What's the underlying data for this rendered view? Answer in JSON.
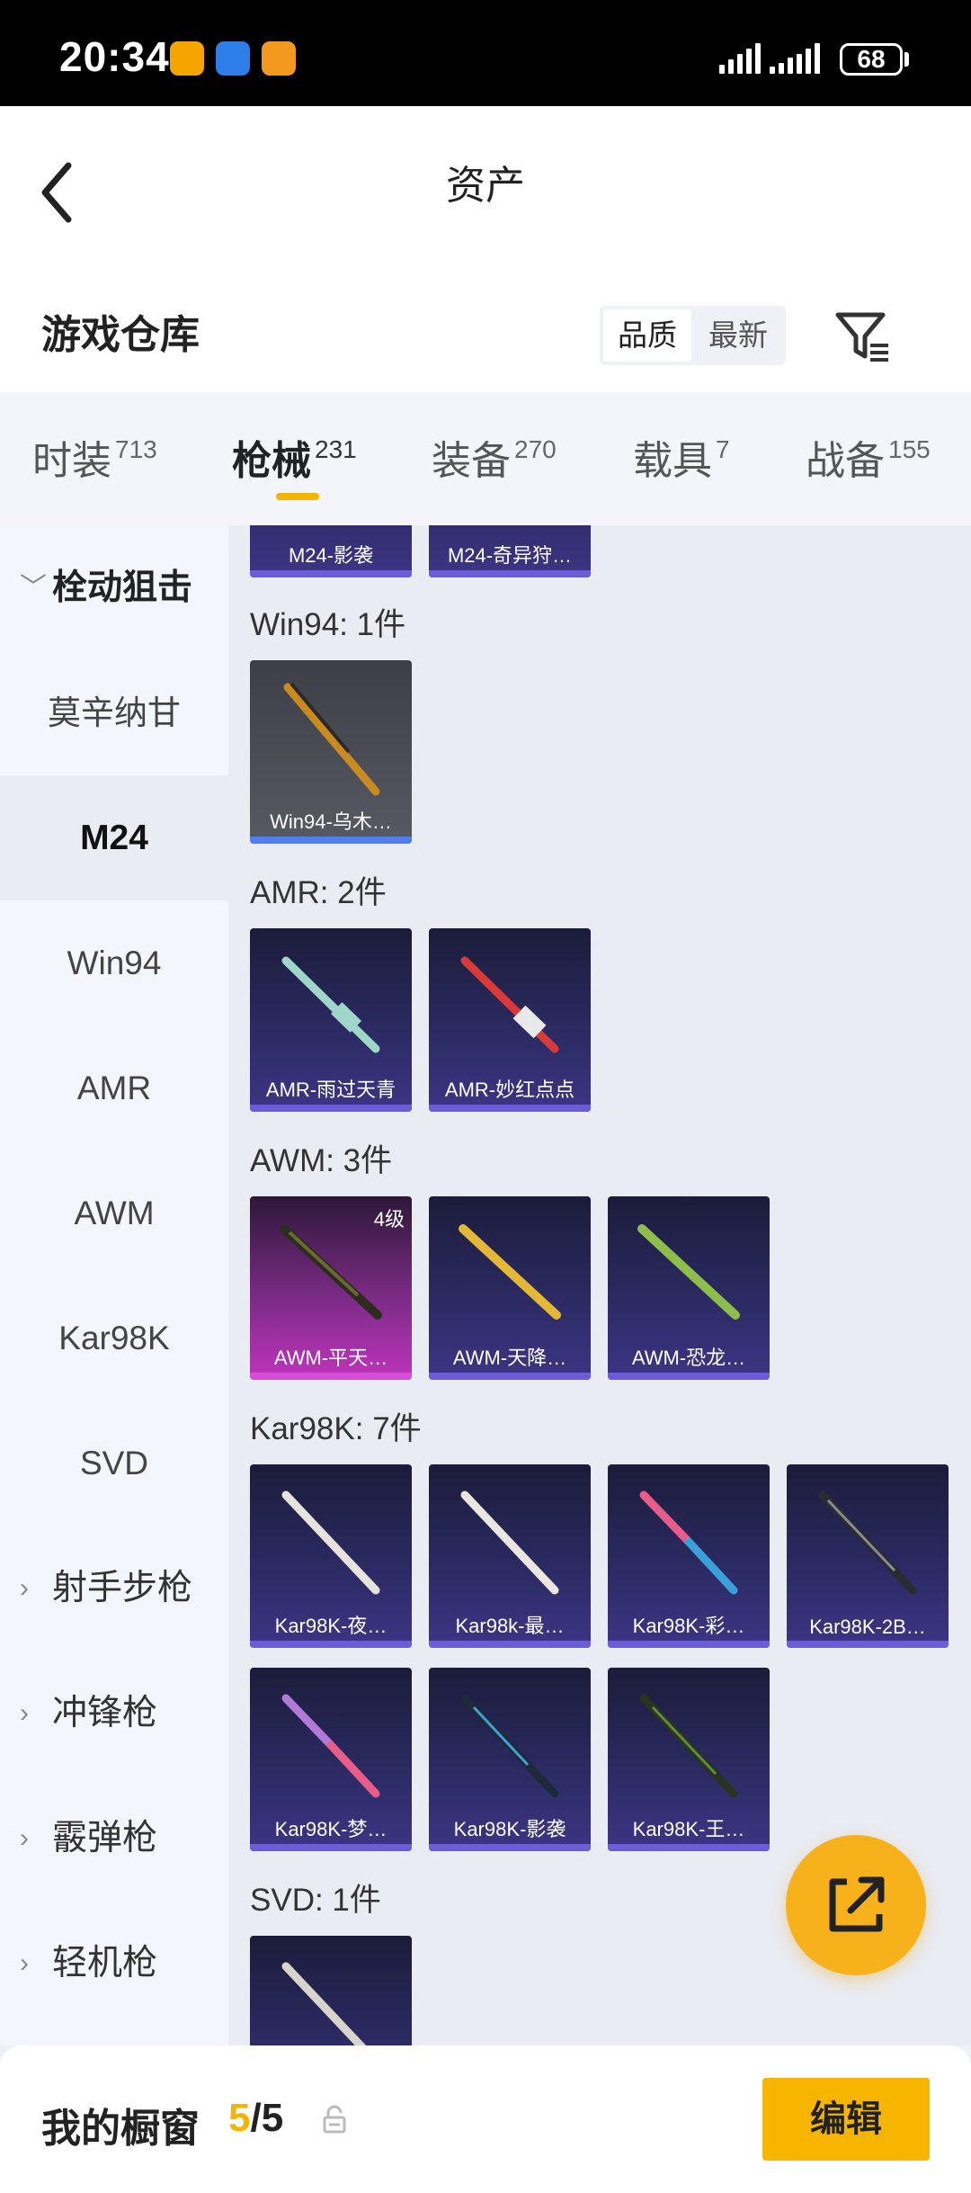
{
  "status_bar": {
    "time": "20:34",
    "battery": "68"
  },
  "header": {
    "title": "资产",
    "section_title": "游戏仓库",
    "sort_active": "品质",
    "sort_other": "最新"
  },
  "tabs": [
    {
      "label": "时装",
      "count": "713"
    },
    {
      "label": "枪械",
      "count": "231"
    },
    {
      "label": "装备",
      "count": "270"
    },
    {
      "label": "载具",
      "count": "7"
    },
    {
      "label": "战备",
      "count": "155"
    }
  ],
  "sidebar": {
    "expanded_group": "栓动狙击",
    "subitems": [
      "莫辛纳甘",
      "M24",
      "Win94",
      "AMR",
      "AWM",
      "Kar98K",
      "SVD"
    ],
    "groups": [
      "射手步枪",
      "冲锋枪",
      "霰弹枪",
      "轻机枪"
    ]
  },
  "content": {
    "top_cards": [
      "M24-影袭",
      "M24-奇异狩…"
    ],
    "groups": [
      {
        "label": "Win94: 1件",
        "cards": [
          {
            "name": "Win94-乌木…"
          }
        ]
      },
      {
        "label": "AMR: 2件",
        "cards": [
          {
            "name": "AMR-雨过天青"
          },
          {
            "name": "AMR-妙红点点"
          }
        ]
      },
      {
        "label": "AWM: 3件",
        "cards": [
          {
            "name": "AWM-平天…",
            "level": "4级"
          },
          {
            "name": "AWM-天降…"
          },
          {
            "name": "AWM-恐龙…"
          }
        ]
      },
      {
        "label": "Kar98K: 7件",
        "cards": [
          {
            "name": "Kar98K-夜…"
          },
          {
            "name": "Kar98k-最…"
          },
          {
            "name": "Kar98K-彩…"
          },
          {
            "name": "Kar98K-2B…"
          },
          {
            "name": "Kar98K-梦…"
          },
          {
            "name": "Kar98K-影袭"
          },
          {
            "name": "Kar98K-王…"
          }
        ]
      },
      {
        "label": "SVD: 1件",
        "cards": []
      }
    ],
    "gun_colors": {
      "win94": "#c98a1f",
      "amr1": "#9fd6c9",
      "amr2": "#d83a3a",
      "awm1": "#6b6a2e",
      "awm2": "#e4b736",
      "awm3": "#8dbd4a",
      "kar_light": "#e8e2dc",
      "kar_pink": "#e85c8a",
      "kar_dark": "#2b2b33",
      "kar_blue": "#3aa0d8",
      "kar_green": "#5f8a3a"
    }
  },
  "bottom_bar": {
    "label": "我的橱窗",
    "current": "5",
    "total": "/5",
    "edit_label": "编辑"
  },
  "colors": {
    "accent": "#f7b500",
    "card_purple": "#3d3585"
  }
}
